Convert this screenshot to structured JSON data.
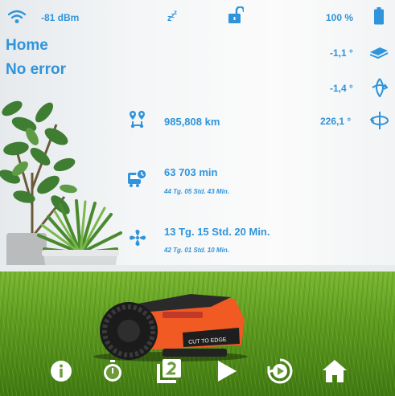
{
  "status": {
    "wifi_signal": "-81 dBm",
    "sleep_icon": "zzz-icon",
    "lock_icon": "unlocked-padlock-icon",
    "battery": "100 %"
  },
  "state": {
    "location": "Home",
    "error": "No error"
  },
  "sensors": {
    "pitch": "-1,1 °",
    "roll": "-1,4 °",
    "yaw": "226,1 °"
  },
  "stats": {
    "distance": "985,808 km",
    "blade_time": "63 703 min",
    "blade_time_detail": "44 Tg. 05 Std. 43 Min.",
    "work_time": "13 Tg. 15 Std. 20 Min.",
    "work_time_detail": "42 Tg. 01 Std. 10 Min."
  },
  "mower_label": "CUT TO EDGE",
  "nav": [
    {
      "icon": "info-icon"
    },
    {
      "icon": "stopwatch-icon"
    },
    {
      "icon": "zone-2-icon"
    },
    {
      "icon": "play-icon"
    },
    {
      "icon": "replay-icon"
    },
    {
      "icon": "home-icon"
    }
  ],
  "colors": {
    "accent": "#2f94db",
    "nav_icon": "#ffffff",
    "mower_orange": "#f15a22"
  }
}
